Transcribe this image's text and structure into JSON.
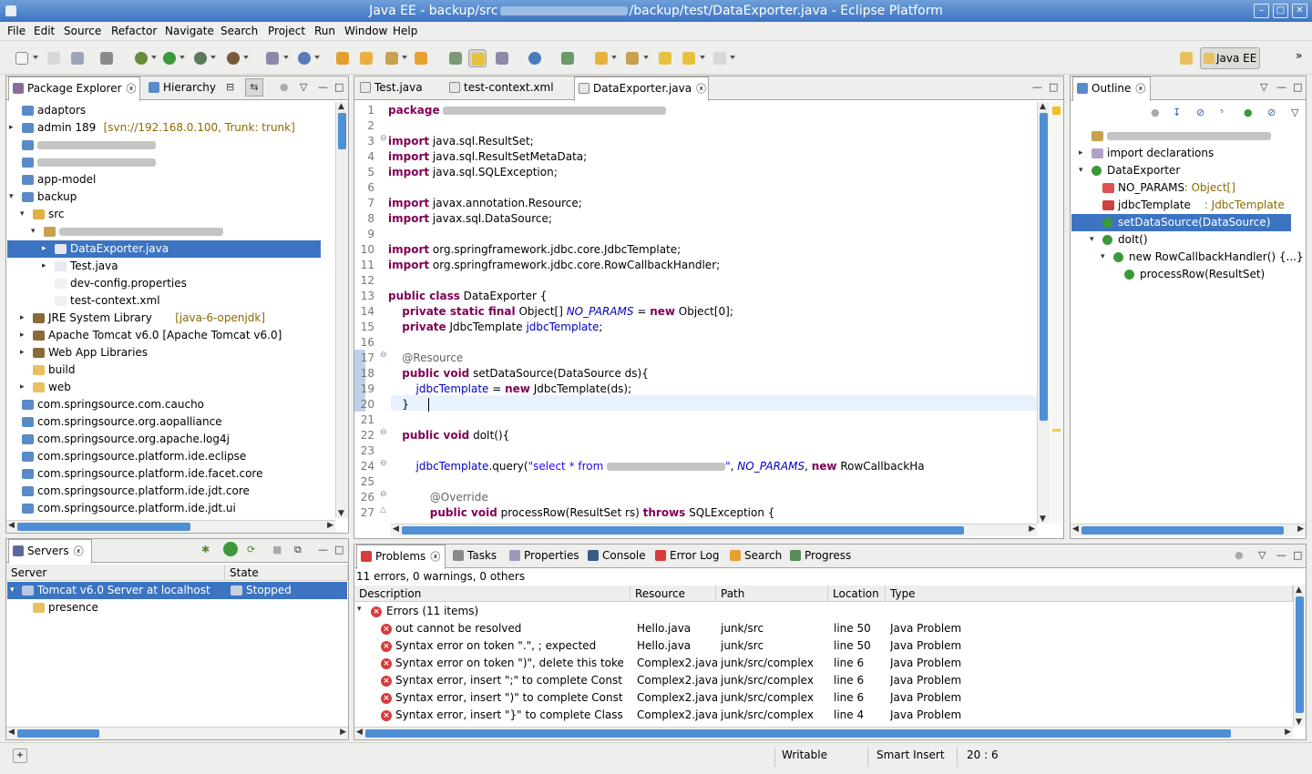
{
  "window": {
    "title_prefix": "Java EE - backup/src",
    "title_suffix": "/backup/test/DataExporter.java - Eclipse Platform"
  },
  "menu": [
    "File",
    "Edit",
    "Source",
    "Refactor",
    "Navigate",
    "Search",
    "Project",
    "Run",
    "Window",
    "Help"
  ],
  "perspective": {
    "label": "Java EE"
  },
  "package_explorer": {
    "tabs": [
      {
        "label": "Package Explorer",
        "close": "ⓧ"
      },
      {
        "label": "Hierarchy"
      }
    ],
    "items": [
      {
        "label": "adaptors",
        "indent": 0,
        "twist": "",
        "icon": "project-icon"
      },
      {
        "label": "admin 189",
        "suffix": "[svn://192.168.0.100, Trunk: trunk]",
        "indent": 0,
        "twist": "▸",
        "icon": "project-icon"
      },
      {
        "label": "",
        "indent": 0,
        "twist": "",
        "icon": "project-icon",
        "blur": 130
      },
      {
        "label": "",
        "indent": 0,
        "twist": "",
        "icon": "project-icon",
        "blur": 130
      },
      {
        "label": "app-model",
        "indent": 0,
        "twist": "",
        "icon": "project-icon"
      },
      {
        "label": "backup",
        "indent": 0,
        "twist": "▾",
        "icon": "project-icon"
      },
      {
        "label": "src",
        "indent": 1,
        "twist": "▾",
        "icon": "source-folder-icon"
      },
      {
        "label": "",
        "indent": 2,
        "twist": "▾",
        "icon": "package-icon",
        "blur": 180
      },
      {
        "label": "DataExporter.java",
        "indent": 3,
        "twist": "▸",
        "icon": "java-file-icon",
        "selected": true
      },
      {
        "label": "Test.java",
        "indent": 3,
        "twist": "▸",
        "icon": "java-file-icon"
      },
      {
        "label": "dev-config.properties",
        "indent": 3,
        "twist": "",
        "icon": "file-icon"
      },
      {
        "label": "test-context.xml",
        "indent": 3,
        "twist": "",
        "icon": "xml-file-icon"
      },
      {
        "label": "JRE System Library",
        "suffix": "[java-6-openjdk]",
        "indent": 1,
        "twist": "▸",
        "icon": "library-icon"
      },
      {
        "label": "Apache Tomcat v6.0 [Apache Tomcat v6.0]",
        "indent": 1,
        "twist": "▸",
        "icon": "library-icon"
      },
      {
        "label": "Web App Libraries",
        "indent": 1,
        "twist": "▸",
        "icon": "library-icon"
      },
      {
        "label": "build",
        "indent": 1,
        "twist": "",
        "icon": "folder-icon"
      },
      {
        "label": "web",
        "indent": 1,
        "twist": "▸",
        "icon": "folder-icon"
      },
      {
        "label": "com.springsource.com.caucho",
        "indent": 0,
        "twist": "",
        "icon": "project-icon"
      },
      {
        "label": "com.springsource.org.aopalliance",
        "indent": 0,
        "twist": "",
        "icon": "project-icon"
      },
      {
        "label": "com.springsource.org.apache.log4j",
        "indent": 0,
        "twist": "",
        "icon": "project-icon"
      },
      {
        "label": "com.springsource.platform.ide.eclipse",
        "indent": 0,
        "twist": "",
        "icon": "project-icon"
      },
      {
        "label": "com.springsource.platform.ide.facet.core",
        "indent": 0,
        "twist": "",
        "icon": "project-icon"
      },
      {
        "label": "com.springsource.platform.ide.jdt.core",
        "indent": 0,
        "twist": "",
        "icon": "project-icon"
      },
      {
        "label": "com.springsource.platform.ide.jdt.ui",
        "indent": 0,
        "twist": "",
        "icon": "project-icon"
      }
    ]
  },
  "servers": {
    "tab": {
      "label": "Servers",
      "close": "ⓧ"
    },
    "columns": [
      "Server",
      "State"
    ],
    "rows": [
      {
        "server": "Tomcat v6.0 Server at localhost",
        "state": "Stopped",
        "selected": true
      },
      {
        "server": "presence",
        "state": "",
        "indent": 1
      }
    ]
  },
  "editor": {
    "tabs": [
      {
        "label": "Test.java"
      },
      {
        "label": "test-context.xml"
      },
      {
        "label": "DataExporter.java",
        "close": "ⓧ",
        "active": true
      }
    ],
    "lines": [
      {
        "n": "1",
        "html": "<span class='kw'>package</span> <span class='blurbar' style='width:245px'></span>"
      },
      {
        "n": "2",
        "html": ""
      },
      {
        "n": "3",
        "fold": "⊖",
        "html": "<span class='kw'>import</span> java.sql.ResultSet;"
      },
      {
        "n": "4",
        "html": "<span class='kw'>import</span> java.sql.ResultSetMetaData;"
      },
      {
        "n": "5",
        "html": "<span class='kw'>import</span> java.sql.SQLException;"
      },
      {
        "n": "6",
        "html": ""
      },
      {
        "n": "7",
        "html": "<span class='kw'>import</span> javax.annotation.Resource;"
      },
      {
        "n": "8",
        "html": "<span class='kw'>import</span> javax.sql.DataSource;"
      },
      {
        "n": "9",
        "html": ""
      },
      {
        "n": "10",
        "html": "<span class='kw'>import</span> org.springframework.jdbc.core.JdbcTemplate;"
      },
      {
        "n": "11",
        "html": "<span class='kw'>import</span> org.springframework.jdbc.core.RowCallbackHandler;"
      },
      {
        "n": "12",
        "html": ""
      },
      {
        "n": "13",
        "html": "<span class='kw'>public class</span> DataExporter {"
      },
      {
        "n": "14",
        "html": "    <span class='kw'>private static final</span> Object[] <span class='sfld'>NO_PARAMS</span> = <span class='kw'>new</span> Object[0];"
      },
      {
        "n": "15",
        "html": "    <span class='kw'>private</span> JdbcTemplate <span class='fld'>jdbcTemplate</span>;"
      },
      {
        "n": "16",
        "html": ""
      },
      {
        "n": "17",
        "fold": "⊖",
        "html": "    <span class='ann'>@Resource</span>"
      },
      {
        "n": "18",
        "html": "    <span class='kw'>public void</span> setDataSource(DataSource ds){"
      },
      {
        "n": "19",
        "html": "        <span class='fld'>jdbcTemplate</span> = <span class='kw'>new</span> JdbcTemplate(ds);"
      },
      {
        "n": "20",
        "html": "    }",
        "current": true
      },
      {
        "n": "21",
        "html": ""
      },
      {
        "n": "22",
        "fold": "⊖",
        "html": "    <span class='kw'>public void</span> doIt(){"
      },
      {
        "n": "23",
        "html": ""
      },
      {
        "n": "24",
        "fold": "⊖",
        "html": "        <span class='fld'>jdbcTemplate</span>.query(<span class='str'>\"select * from <span class='blurbar' style='width:130px'></span>\"</span>, <span class='sfld'>NO_PARAMS</span>, <span class='kw'>new</span> RowCallbackHa"
      },
      {
        "n": "25",
        "html": ""
      },
      {
        "n": "26",
        "fold": "⊖",
        "html": "            <span class='ann'>@Override</span>"
      },
      {
        "n": "27",
        "fold": "△",
        "html": "            <span class='kw'>public void</span> processRow(ResultSet rs) <span class='kw'>throws</span> SQLException {"
      }
    ]
  },
  "outline": {
    "tab": {
      "label": "Outline",
      "close": "ⓧ"
    },
    "items": [
      {
        "label": "",
        "indent": 0,
        "twist": "",
        "icon": "package-icon",
        "blur": 180
      },
      {
        "label": "import declarations",
        "indent": 0,
        "twist": "▸",
        "icon": "imports-icon"
      },
      {
        "label": "DataExporter",
        "indent": 0,
        "twist": "▾",
        "icon": "class-icon"
      },
      {
        "label": "NO_PARAMS",
        "suffix": ": Object[]",
        "indent": 1,
        "twist": "",
        "icon": "static-field-icon"
      },
      {
        "label": "jdbcTemplate",
        "suffix": ": JdbcTemplate",
        "indent": 1,
        "twist": "",
        "icon": "private-field-icon"
      },
      {
        "label": "setDataSource(DataSource)",
        "indent": 1,
        "twist": "",
        "icon": "method-icon",
        "selected": true
      },
      {
        "label": "doIt()",
        "indent": 1,
        "twist": "▾",
        "icon": "method-icon"
      },
      {
        "label": "new RowCallbackHandler() {...}",
        "indent": 2,
        "twist": "▾",
        "icon": "anon-class-icon"
      },
      {
        "label": "processRow(ResultSet)",
        "indent": 3,
        "twist": "",
        "icon": "method-icon"
      }
    ]
  },
  "problems": {
    "tabs": [
      {
        "label": "Problems",
        "close": "ⓧ",
        "active": true
      },
      {
        "label": "Tasks"
      },
      {
        "label": "Properties"
      },
      {
        "label": "Console"
      },
      {
        "label": "Error Log"
      },
      {
        "label": "Search"
      },
      {
        "label": "Progress"
      }
    ],
    "summary": "11 errors, 0 warnings, 0 others",
    "columns": [
      "Description",
      "Resource",
      "Path",
      "Location",
      "Type"
    ],
    "group": "Errors (11 items)",
    "rows": [
      {
        "description": "out cannot be resolved",
        "resource": "Hello.java",
        "path": "junk/src",
        "location": "line 50",
        "type": "Java Problem"
      },
      {
        "description": "Syntax error on token \".\", ; expected",
        "resource": "Hello.java",
        "path": "junk/src",
        "location": "line 50",
        "type": "Java Problem"
      },
      {
        "description": "Syntax error on token \")\", delete this token",
        "resource": "Complex2.java",
        "path": "junk/src/complex",
        "location": "line 6",
        "type": "Java Problem"
      },
      {
        "description": "Syntax error, insert \";\" to complete ConstructorDeclaration",
        "resource": "Complex2.java",
        "path": "junk/src/complex",
        "location": "line 6",
        "type": "Java Problem"
      },
      {
        "description": "Syntax error, insert \")\" to complete ConstructorDeclaration",
        "resource": "Complex2.java",
        "path": "junk/src/complex",
        "location": "line 6",
        "type": "Java Problem"
      },
      {
        "description": "Syntax error, insert \"}\" to complete ClassBody",
        "resource": "Complex2.java",
        "path": "junk/src/complex",
        "location": "line 4",
        "type": "Java Problem"
      }
    ]
  },
  "status": {
    "writable": "Writable",
    "insert_mode": "Smart Insert",
    "position": "20 : 6"
  },
  "colors": {
    "selection": "#3c74c2",
    "title_gradient_top": "#6f9fd8",
    "keyword": "#7f0055",
    "field": "#0000c0",
    "string": "#2a00ff"
  }
}
